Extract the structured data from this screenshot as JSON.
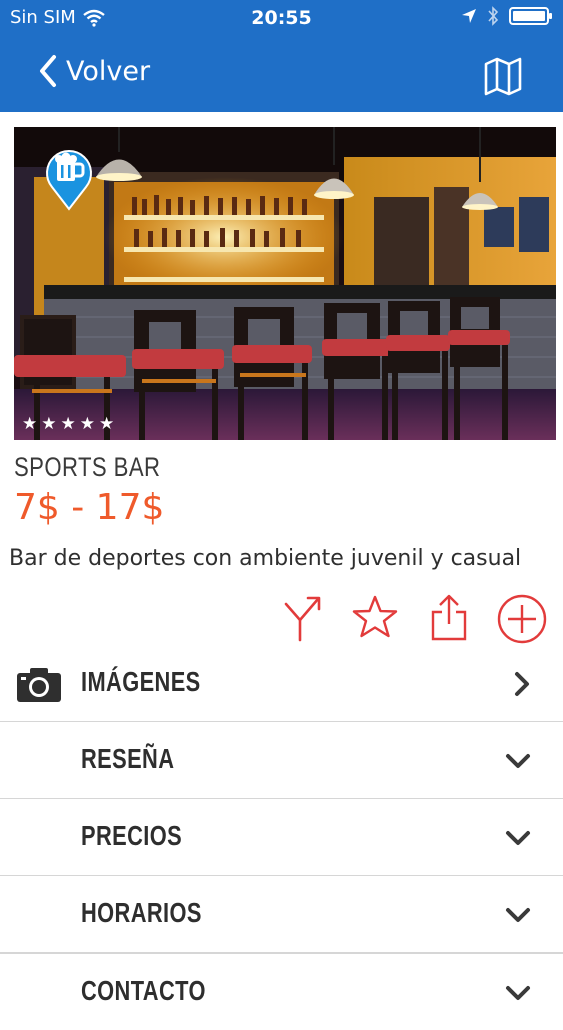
{
  "status_bar": {
    "carrier": "Sin SIM",
    "time": "20:55"
  },
  "nav": {
    "back_label": "Volver",
    "map_icon": "map-icon"
  },
  "venue": {
    "name": "SPORTS BAR",
    "price_range": "7$ - 17$",
    "description": "Bar de deportes con ambiente juvenil y casual",
    "rating": 5,
    "rating_max": 5,
    "category_icon": "beer-mug-icon"
  },
  "actions": [
    {
      "name": "route-icon"
    },
    {
      "name": "star-outline-icon"
    },
    {
      "name": "share-icon"
    },
    {
      "name": "add-circle-icon"
    }
  ],
  "sections": [
    {
      "label": "IMÁGENES",
      "icon": "camera-icon",
      "chevron": "right"
    },
    {
      "label": "RESEÑA",
      "chevron": "down"
    },
    {
      "label": "PRECIOS",
      "chevron": "down"
    },
    {
      "label": "HORARIOS",
      "chevron": "down"
    },
    {
      "label": "CONTACTO",
      "chevron": "down"
    }
  ],
  "colors": {
    "primary": "#1f6fc7",
    "accent": "#ef5a2b",
    "action_red": "#e23b3b"
  }
}
